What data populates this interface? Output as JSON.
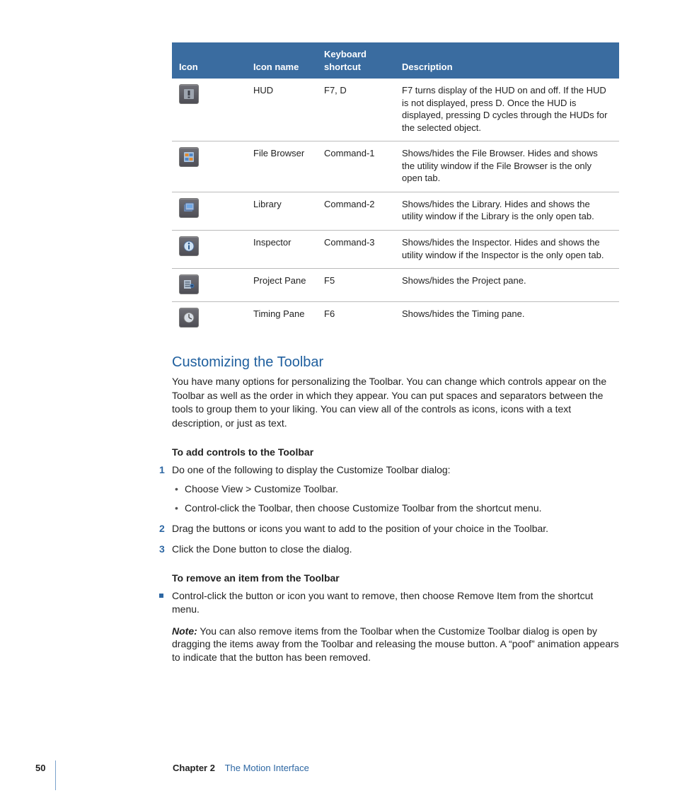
{
  "table": {
    "headers": [
      "Icon",
      "Icon name",
      "Keyboard shortcut",
      "Description"
    ],
    "rows": [
      {
        "icon": "hud",
        "name": "HUD",
        "shortcut": "F7, D",
        "desc": "F7 turns display of the HUD on and off. If the HUD is not displayed, press D. Once the HUD is displayed, pressing D cycles through the HUDs for the selected object."
      },
      {
        "icon": "file-browser",
        "name": "File Browser",
        "shortcut": "Command-1",
        "desc": "Shows/hides the File Browser. Hides and shows the utility window if the File Browser is the only open tab."
      },
      {
        "icon": "library",
        "name": "Library",
        "shortcut": "Command-2",
        "desc": "Shows/hides the Library. Hides and shows the utility window if the Library is the only open tab."
      },
      {
        "icon": "inspector",
        "name": "Inspector",
        "shortcut": "Command-3",
        "desc": "Shows/hides the Inspector. Hides and shows the utility window if the Inspector is the only open tab."
      },
      {
        "icon": "project-pane",
        "name": "Project Pane",
        "shortcut": "F5",
        "desc": "Shows/hides the Project pane."
      },
      {
        "icon": "timing-pane",
        "name": "Timing Pane",
        "shortcut": "F6",
        "desc": "Shows/hides the Timing pane."
      }
    ]
  },
  "section": {
    "heading": "Customizing the Toolbar",
    "intro": "You have many options for personalizing the Toolbar. You can change which controls appear on the Toolbar as well as the order in which they appear. You can put spaces and separators between the tools to group them to your liking. You can view all of the controls as icons, icons with a text description, or just as text.",
    "add": {
      "title": "To add controls to the Toolbar",
      "steps": [
        "Do one of the following to display the Customize Toolbar dialog:",
        "Drag the buttons or icons you want to add to the position of your choice in the Toolbar.",
        "Click the Done button to close the dialog."
      ],
      "subbullets": [
        "Choose View > Customize Toolbar.",
        "Control-click the Toolbar, then choose Customize Toolbar from the shortcut menu."
      ]
    },
    "remove": {
      "title": "To remove an item from the Toolbar",
      "step": "Control-click the button or icon you want to remove, then choose Remove Item from the shortcut menu.",
      "note_label": "Note:",
      "note_body": "  You can also remove items from the Toolbar when the Customize Toolbar dialog is open by dragging the items away from the Toolbar and releasing the mouse button. A “poof” animation appears to indicate that the button has been removed."
    }
  },
  "footer": {
    "page": "50",
    "chapter_label": "Chapter 2",
    "chapter_title": "The Motion Interface"
  }
}
